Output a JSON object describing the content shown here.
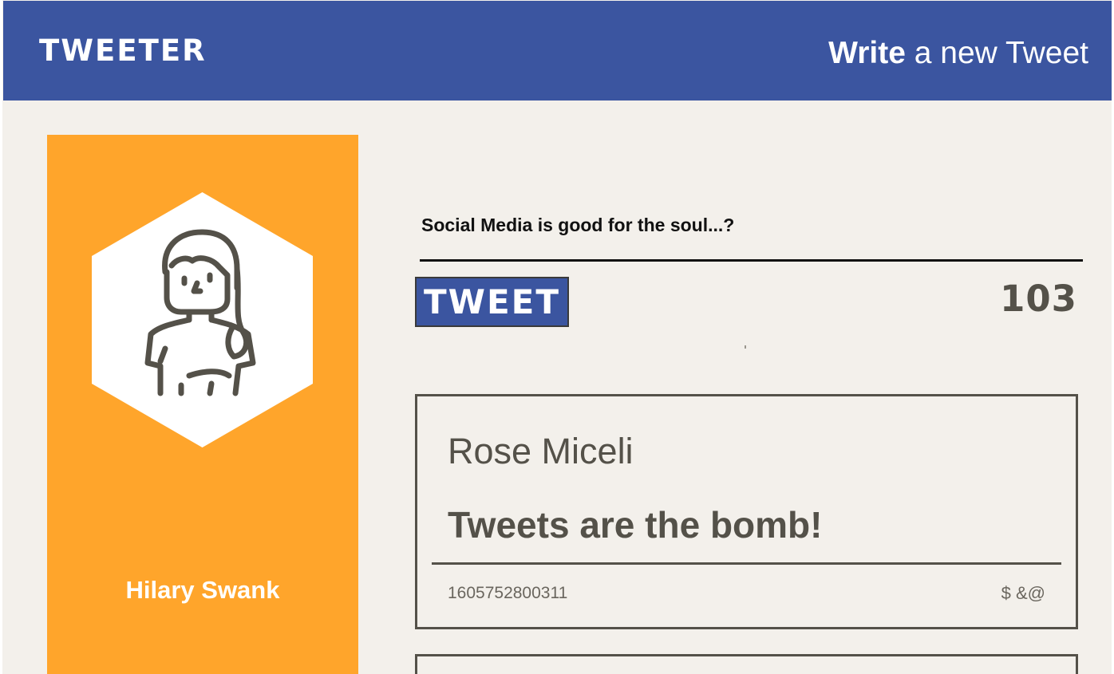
{
  "header": {
    "brand": "TWEETER",
    "compose_toggle": {
      "strong": "Write",
      "light": " a new Tweet"
    }
  },
  "profile": {
    "name": "Hilary Swank",
    "avatar_icon": "woman-avatar-icon"
  },
  "composer": {
    "input_value": "Social Media is good for the soul...?",
    "button_label": "TWEET",
    "counter": "103"
  },
  "tweets": [
    {
      "author": "Rose Miceli",
      "text": "Tweets are the bomb!",
      "timestamp": "1605752800311",
      "actions": {
        "flag": "$",
        "retweet": "&",
        "like": "@"
      }
    }
  ],
  "colors": {
    "nav_bg": "#3b55a0",
    "profile_bg": "#ffa52b",
    "page_bg": "#f3f0eb",
    "text_dark": "#545149"
  }
}
